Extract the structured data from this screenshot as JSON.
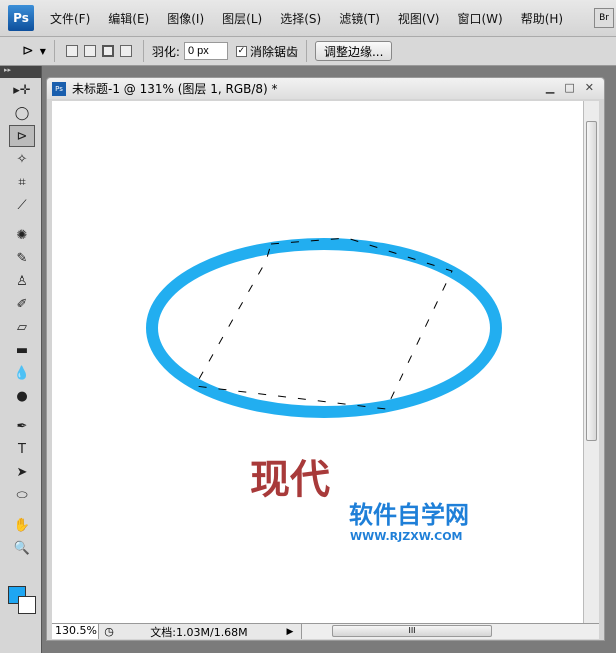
{
  "app": {
    "logo": "Ps",
    "bridge": "Br"
  },
  "menu": [
    "文件(F)",
    "编辑(E)",
    "图像(I)",
    "图层(L)",
    "选择(S)",
    "滤镜(T)",
    "视图(V)",
    "窗口(W)",
    "帮助(H)"
  ],
  "options": {
    "feather_label": "羽化:",
    "feather_value": "0 px",
    "antialias_label": "消除锯齿",
    "antialias_checked": true,
    "refine_button": "调整边缘..."
  },
  "document": {
    "title": "未标题-1 @ 131% (图层 1, RGB/8) *",
    "zoom": "130.5%",
    "doc_info": "文档:1.03M/1.68M"
  },
  "canvas": {
    "text": "现代",
    "watermark_cn": "软件自学网",
    "watermark_url": "WWW.RJZXW.COM"
  },
  "colors": {
    "foreground": "#1ea6f2",
    "background": "#ffffff",
    "ellipse": "#22aef0",
    "text": "#a83a3a",
    "watermark": "#1e7fd8"
  },
  "tools": [
    "move-icon",
    "elliptical-marquee-icon",
    "polygonal-lasso-icon",
    "magic-wand-icon",
    "crop-icon",
    "eyedropper-icon",
    "healing-brush-icon",
    "brush-icon",
    "clone-stamp-icon",
    "history-brush-icon",
    "eraser-icon",
    "gradient-icon",
    "blur-icon",
    "dodge-icon",
    "pen-icon",
    "type-icon",
    "path-selection-icon",
    "ellipse-shape-icon",
    "hand-icon",
    "zoom-icon"
  ]
}
